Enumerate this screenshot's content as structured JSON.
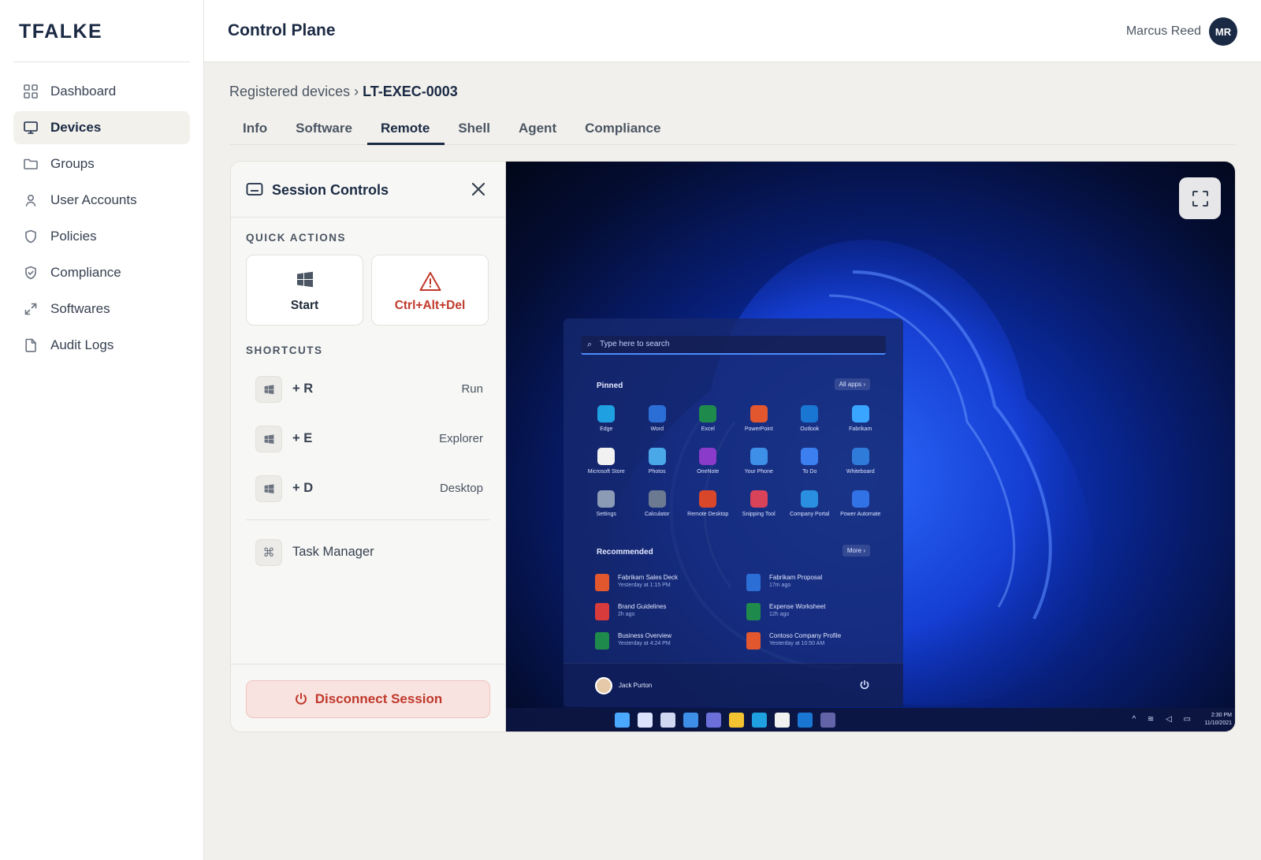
{
  "brand": "TFALKE",
  "sidebar": {
    "items": [
      {
        "label": "Dashboard",
        "icon": "grid-icon"
      },
      {
        "label": "Devices",
        "icon": "monitor-icon",
        "active": true
      },
      {
        "label": "Groups",
        "icon": "folder-icon"
      },
      {
        "label": "User Accounts",
        "icon": "user-icon"
      },
      {
        "label": "Policies",
        "icon": "shield-icon"
      },
      {
        "label": "Compliance",
        "icon": "shield-check-icon"
      },
      {
        "label": "Softwares",
        "icon": "expand-arrows-icon"
      },
      {
        "label": "Audit Logs",
        "icon": "document-icon"
      }
    ]
  },
  "header": {
    "title": "Control Plane",
    "user_name": "Marcus Reed",
    "user_initials": "MR"
  },
  "breadcrumb": {
    "parent": "Registered devices",
    "separator": "›",
    "current": "LT-EXEC-0003"
  },
  "tabs": [
    {
      "label": "Info"
    },
    {
      "label": "Software"
    },
    {
      "label": "Remote",
      "active": true
    },
    {
      "label": "Shell"
    },
    {
      "label": "Agent"
    },
    {
      "label": "Compliance"
    }
  ],
  "session": {
    "title": "Session Controls",
    "quick_actions_label": "QUICK ACTIONS",
    "quick_actions": [
      {
        "label": "Start",
        "icon": "windows-icon"
      },
      {
        "label": "Ctrl+Alt+Del",
        "icon": "warning-triangle-icon"
      }
    ],
    "shortcuts_label": "SHORTCUTS",
    "shortcuts": [
      {
        "key": "+ R",
        "name": "Run"
      },
      {
        "key": "+ E",
        "name": "Explorer"
      },
      {
        "key": "+ D",
        "name": "Desktop"
      }
    ],
    "task_manager": {
      "label": "Task Manager",
      "icon": "command-icon"
    },
    "disconnect_label": "Disconnect Session"
  },
  "remote_screen": {
    "search_placeholder": "Type here to search",
    "pinned_label": "Pinned",
    "all_apps_label": "All apps  ›",
    "pinned_apps": [
      {
        "name": "Edge",
        "color": "#1fa0e0"
      },
      {
        "name": "Word",
        "color": "#2b6fd6"
      },
      {
        "name": "Excel",
        "color": "#1e8a4c"
      },
      {
        "name": "PowerPoint",
        "color": "#e2572e"
      },
      {
        "name": "Outlook",
        "color": "#1976d2"
      },
      {
        "name": "Fabrikam",
        "color": "#3aa5ff"
      },
      {
        "name": "Microsoft Store",
        "color": "#f1f1f1"
      },
      {
        "name": "Photos",
        "color": "#4aa8e8"
      },
      {
        "name": "OneNote",
        "color": "#8a3bc9"
      },
      {
        "name": "Your Phone",
        "color": "#3d8fe8"
      },
      {
        "name": "To Do",
        "color": "#3b7ff0"
      },
      {
        "name": "Whiteboard",
        "color": "#2f7bd9"
      },
      {
        "name": "Settings",
        "color": "#8c9bb5"
      },
      {
        "name": "Calculator",
        "color": "#6b7a90"
      },
      {
        "name": "Remote Desktop",
        "color": "#d9472b"
      },
      {
        "name": "Snipping Tool",
        "color": "#d8435a"
      },
      {
        "name": "Company Portal",
        "color": "#2a8fe0"
      },
      {
        "name": "Power Automate",
        "color": "#3172e6"
      }
    ],
    "recommended_label": "Recommended",
    "more_label": "More  ›",
    "recommended": [
      {
        "name": "Fabrikam Sales Deck",
        "time": "Yesterday at 1:15 PM",
        "color": "#e2572e"
      },
      {
        "name": "Fabrikam Proposal",
        "time": "17m ago",
        "color": "#2b6fd6"
      },
      {
        "name": "Brand Guidelines",
        "time": "2h ago",
        "color": "#d83b3b"
      },
      {
        "name": "Expense Worksheet",
        "time": "12h ago",
        "color": "#1e8a4c"
      },
      {
        "name": "Business Overview",
        "time": "Yesterday at 4:24 PM",
        "color": "#1e8a4c"
      },
      {
        "name": "Contoso Company Profile",
        "time": "Yesterday at 10:50 AM",
        "color": "#e2572e"
      }
    ],
    "user_name": "Jack Purton",
    "taskbar_icons": [
      {
        "name": "windows-start-icon",
        "color": "#4aa8ff"
      },
      {
        "name": "search-icon",
        "color": "#dbe3ff"
      },
      {
        "name": "task-view-icon",
        "color": "#cfd8f0"
      },
      {
        "name": "widgets-icon",
        "color": "#3d8fe8"
      },
      {
        "name": "chat-icon",
        "color": "#6b6fd9"
      },
      {
        "name": "file-explorer-icon",
        "color": "#f2c230"
      },
      {
        "name": "edge-icon",
        "color": "#1fa0e0"
      },
      {
        "name": "store-icon",
        "color": "#f1f1f1"
      },
      {
        "name": "outlook-icon",
        "color": "#1976d2"
      },
      {
        "name": "teams-icon",
        "color": "#6264a7"
      }
    ],
    "tray": "^ ≋ ◁ ▭",
    "clock_time": "2:30 PM",
    "clock_date": "11/10/2021"
  },
  "colors": {
    "brand_navy": "#1b2a44",
    "danger": "#c0392b",
    "danger_bg": "#f8e3e1",
    "page_bg": "#f1f0ec"
  }
}
